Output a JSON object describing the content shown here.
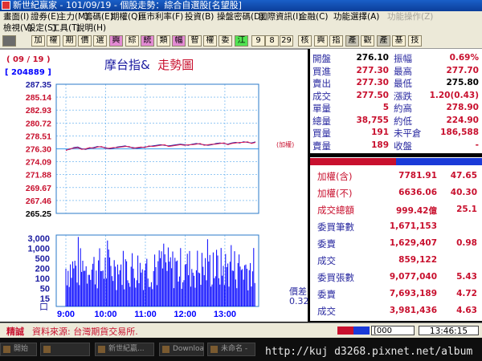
{
  "window": {
    "title": "新世紀贏家 - 101/09/19 - 個股走勢：綜合自選股[名望股]"
  },
  "menu1": [
    {
      "label": "畫面(I)",
      "disabled": false
    },
    {
      "label": "證券(E)",
      "disabled": false
    },
    {
      "label": "主力(M)",
      "disabled": false
    },
    {
      "label": "籌碼(E)",
      "disabled": false
    },
    {
      "label": "期權(Q)",
      "disabled": false
    },
    {
      "label": "匯市利率(F)",
      "disabled": false
    },
    {
      "label": "投資(B)",
      "disabled": false
    },
    {
      "label": "操盤密碼(D)",
      "disabled": false
    },
    {
      "label": "國際資訊(I)",
      "disabled": false
    },
    {
      "label": "金融(C)",
      "disabled": false
    },
    {
      "label": "功能選擇(A)",
      "disabled": false
    },
    {
      "label": "功能操作(Z)",
      "disabled": true
    }
  ],
  "menu2": [
    {
      "label": "檢視(V)"
    },
    {
      "label": "設定(S)"
    },
    {
      "label": "工具(T)"
    },
    {
      "label": "說明(H)"
    }
  ],
  "toolbar": [
    {
      "label": "",
      "style": "dark"
    },
    {
      "label": "加",
      "style": ""
    },
    {
      "label": "權",
      "style": ""
    },
    {
      "label": "期",
      "style": ""
    },
    {
      "label": "價",
      "style": ""
    },
    {
      "label": "選",
      "style": ""
    },
    {
      "label": "興",
      "style": "pink"
    },
    {
      "label": "綜",
      "style": ""
    },
    {
      "label": "統",
      "style": "pink"
    },
    {
      "label": "類",
      "style": ""
    },
    {
      "label": "幅",
      "style": "pink"
    },
    {
      "label": "智",
      "style": ""
    },
    {
      "label": "權",
      "style": ""
    },
    {
      "label": "委",
      "style": ""
    },
    {
      "label": "江",
      "style": "green"
    },
    {
      "label": "9",
      "style": ""
    },
    {
      "label": "8",
      "style": ""
    },
    {
      "label": "29",
      "style": ""
    },
    {
      "label": "核",
      "style": ""
    },
    {
      "label": "興",
      "style": ""
    },
    {
      "label": "指",
      "style": ""
    },
    {
      "label": "產",
      "style": "gray"
    },
    {
      "label": "觀",
      "style": ""
    },
    {
      "label": "產",
      "style": "gray"
    },
    {
      "label": "基",
      "style": ""
    },
    {
      "label": "技",
      "style": ""
    }
  ],
  "chart": {
    "date": "( 09 / 19 )",
    "contracts": "[ 204889 ]",
    "title_main": "摩台指&",
    "title_sub": "走勢圖",
    "tag_label": "(加權)",
    "ratio_label": "價差",
    "ratio_value": "0.32",
    "vol_unit": "口",
    "colors": {
      "price_line": "#1a1aa0",
      "index_line": "#e0205a",
      "volume": "#0000ff",
      "grid": "#55a8ee",
      "label": "#c8102e"
    }
  },
  "chart_data": {
    "type": "line",
    "y_ticks": [
      "287.35",
      "285.14",
      "282.93",
      "280.72",
      "278.51",
      "276.30",
      "274.09",
      "271.88",
      "269.67",
      "267.46",
      "265.25"
    ],
    "reference_price": "276.30",
    "ylim": [
      265.25,
      287.35
    ],
    "x_ticks": [
      "9:00",
      "10:00",
      "11:00",
      "12:00",
      "13:00"
    ],
    "volume_ticks": [
      "3,000",
      "1,000",
      "500",
      "200",
      "100",
      "50",
      "15"
    ],
    "series": [
      {
        "values": [
          276.1,
          276.2,
          276.5,
          276.6,
          276.3,
          276.2,
          276.4,
          276.5,
          276.7,
          276.6,
          276.5,
          276.3,
          276.4,
          276.6,
          276.7,
          276.8,
          276.6,
          276.5,
          276.4,
          276.5,
          276.6,
          276.7,
          276.8,
          276.9,
          277.0,
          276.9,
          276.8,
          276.9,
          277.0,
          277.1,
          277.0,
          276.9,
          277.1,
          277.2,
          277.1,
          277.0,
          276.9,
          277.0,
          277.2,
          277.3,
          277.2,
          277.1,
          277.3,
          277.4,
          277.3,
          277.5,
          277.4,
          277.3,
          277.5
        ]
      },
      {
        "values": [
          276.0,
          276.3,
          276.4,
          276.5,
          276.2,
          276.3,
          276.5,
          276.4,
          276.6,
          276.7,
          276.4,
          276.4,
          276.5,
          276.5,
          276.6,
          276.7,
          276.7,
          276.4,
          276.5,
          276.6,
          276.5,
          276.8,
          276.7,
          276.8,
          276.9,
          277.0,
          276.7,
          276.8,
          276.9,
          277.0,
          276.9,
          277.0,
          277.0,
          277.1,
          277.2,
          276.9,
          277.0,
          277.1,
          277.1,
          277.2,
          277.3,
          277.0,
          277.2,
          277.3,
          277.4,
          277.4,
          277.5,
          277.2,
          277.4
        ]
      }
    ]
  },
  "quote": [
    {
      "l1": "開盤",
      "v1": "276.10",
      "c1": "#000",
      "l2": "振幅",
      "v2": "0.69%",
      "c2": "#c8102e"
    },
    {
      "l1": "買進",
      "v1": "277.30",
      "c1": "#c8102e",
      "l2": "最高",
      "v2": "277.70",
      "c2": "#c8102e"
    },
    {
      "l1": "賣出",
      "v1": "277.30",
      "c1": "#c8102e",
      "l2": "最低",
      "v2": "275.80",
      "c2": "#000"
    },
    {
      "l1": "成交",
      "v1": "277.50",
      "c1": "#c8102e",
      "l2": "漲跌",
      "v2": "1.20(0.43)",
      "c2": "#c8102e"
    },
    {
      "l1": "單量",
      "v1": "5",
      "c1": "#c8102e",
      "l2": "約高",
      "v2": "278.90",
      "c2": "#c8102e"
    },
    {
      "l1": "總量",
      "v1": "38,755",
      "c1": "#c8102e",
      "l2": "約低",
      "v2": "224.90",
      "c2": "#c8102e"
    },
    {
      "l1": "買量",
      "v1": "191",
      "c1": "#c8102e",
      "l2": "未平倉",
      "v2": "186,588",
      "c2": "#c8102e"
    },
    {
      "l1": "賣量",
      "v1": "189",
      "c1": "#c8102e",
      "l2": "收盤",
      "v2": "-",
      "c2": "#c8102e"
    }
  ],
  "split_bar": {
    "buy_ratio": 0.5,
    "buy_color": "#c8102e",
    "sell_color": "#1a3ad8"
  },
  "stats": [
    {
      "label": "加權(含)",
      "value": "7781.91",
      "value2": "47.65",
      "lc": "#c8102e",
      "vc": "#c8102e"
    },
    {
      "label": "加權(不)",
      "value": "6636.06",
      "value2": "40.30",
      "lc": "#c8102e",
      "vc": "#c8102e"
    },
    {
      "label": "成交總額",
      "value": "999.42億",
      "value2": "25.1",
      "lc": "#c8102e",
      "vc": "#c8102e"
    },
    {
      "label": "委買筆數",
      "value": "1,671,153",
      "value2": "",
      "lc": "#2a2aa0",
      "vc": "#c8102e"
    },
    {
      "label": "委賣",
      "value": "1,629,407",
      "value2": "0.98",
      "lc": "#2a2aa0",
      "vc": "#c8102e"
    },
    {
      "label": "成交",
      "value": "859,122",
      "value2": "",
      "lc": "#2a2aa0",
      "vc": "#c8102e"
    },
    {
      "label": "委買張數",
      "value": "9,077,040",
      "value2": "5.43",
      "lc": "#2a2aa0",
      "vc": "#c8102e"
    },
    {
      "label": "委賣",
      "value": "7,693,189",
      "value2": "4.72",
      "lc": "#2a2aa0",
      "vc": "#c8102e"
    },
    {
      "label": "成交",
      "value": "3,981,436",
      "value2": "4.63",
      "lc": "#2a2aa0",
      "vc": "#c8102e"
    }
  ],
  "status": {
    "tag": "精誠",
    "text": "資料來源: 台灣期貨交易所.",
    "num": "[000",
    "time": "13:46:15"
  },
  "taskbar": [
    {
      "label": "開始"
    },
    {
      "label": ""
    },
    {
      "label": "新世紀贏..."
    },
    {
      "label": "Downloads"
    },
    {
      "label": "未命名 -"
    }
  ],
  "watermark": "http://kuj d3268.pixnet.net/album"
}
